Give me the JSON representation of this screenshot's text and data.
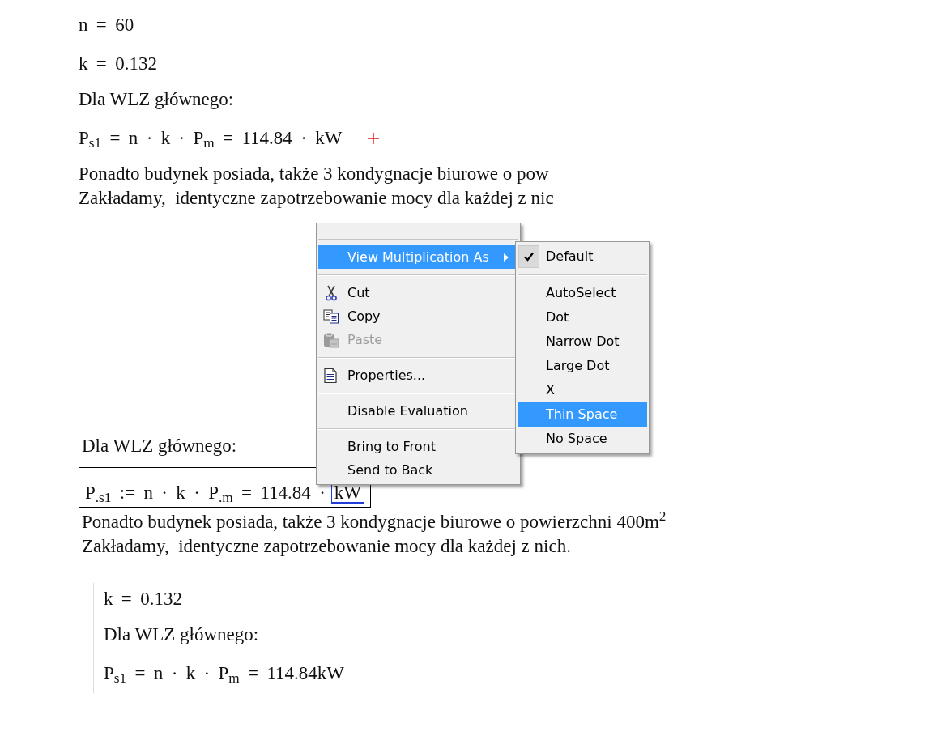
{
  "documents": [
    {
      "kind": "plain",
      "lines": [
        {
          "kind": "math",
          "text": "n = 60",
          "cursor": false
        },
        {
          "kind": "math",
          "text": "k = 0.132",
          "cursor": false
        },
        {
          "kind": "text",
          "text": "Dla WLZ głównego:",
          "cursor": false
        },
        {
          "kind": "math",
          "text": "P$_{s1}$ = n · k · P$_{m}$ = 114.84 · kW",
          "cursor": true
        },
        {
          "kind": "text",
          "text": "Ponadto budynek posiada, także 3 kondygnacje biurowe o pow",
          "cursor": false
        },
        {
          "kind": "text",
          "text": "Zakładamy,  identyczne zapotrzebowanie mocy dla każdej z nic",
          "cursor": false
        }
      ]
    },
    {
      "kind": "plain",
      "lines": [
        {
          "kind": "text",
          "text": "Dla WLZ głównego:",
          "cursor": false
        },
        {
          "kind": "region",
          "text": "P$_{.s1}$ := n · k · P$_{.m}$ = 114.84 ·",
          "edit_field": "kW",
          "cursor": false
        },
        {
          "kind": "text",
          "text": "Ponadto budynek posiada, także 3 kondygnacje biurowe o powierzchni 400m$^{2}$",
          "cursor": false
        },
        {
          "kind": "text",
          "text": "Zakładamy,  identyczne zapotrzebowanie mocy dla każdej z nich.",
          "cursor": false
        }
      ]
    },
    {
      "kind": "ruled",
      "lines": [
        {
          "kind": "math",
          "text": "k = 0.132",
          "cursor": false
        },
        {
          "kind": "text",
          "text": "Dla WLZ głównego:",
          "cursor": false
        },
        {
          "kind": "math",
          "text": "P$_{s1}$ = n · k · P$_{m}$ = 114.84kW",
          "cursor": false
        }
      ]
    }
  ],
  "context_menu": {
    "items": [
      {
        "kind": "separator"
      },
      {
        "kind": "submenu",
        "label": "View Multiplication As",
        "selected": true,
        "disabled": false,
        "submenu": {
          "items": [
            {
              "kind": "item",
              "label": "Default",
              "checked": true,
              "selected": false
            },
            {
              "kind": "separator"
            },
            {
              "kind": "item",
              "label": "AutoSelect",
              "checked": false,
              "selected": false
            },
            {
              "kind": "item",
              "label": "Dot",
              "checked": false,
              "selected": false
            },
            {
              "kind": "item",
              "label": "Narrow Dot",
              "checked": false,
              "selected": false
            },
            {
              "kind": "item",
              "label": "Large Dot",
              "checked": false,
              "selected": false
            },
            {
              "kind": "item",
              "label": "X",
              "checked": false,
              "selected": false
            },
            {
              "kind": "item",
              "label": "Thin Space",
              "checked": false,
              "selected": true
            },
            {
              "kind": "item",
              "label": "No Space",
              "checked": false,
              "selected": false
            }
          ]
        }
      },
      {
        "kind": "separator"
      },
      {
        "kind": "cut",
        "label": "Cut",
        "selected": false,
        "disabled": false
      },
      {
        "kind": "copy",
        "label": "Copy",
        "selected": false,
        "disabled": false
      },
      {
        "kind": "paste",
        "label": "Paste",
        "selected": false,
        "disabled": true
      },
      {
        "kind": "separator"
      },
      {
        "kind": "properties",
        "label": "Properties...",
        "selected": false,
        "disabled": false
      },
      {
        "kind": "separator"
      },
      {
        "kind": "command",
        "label": "Disable Evaluation",
        "selected": false,
        "disabled": false
      },
      {
        "kind": "separator"
      },
      {
        "kind": "command",
        "label": "Bring to Front",
        "selected": false,
        "disabled": false
      },
      {
        "kind": "command",
        "label": "Send to Back",
        "selected": false,
        "disabled": false
      }
    ]
  }
}
